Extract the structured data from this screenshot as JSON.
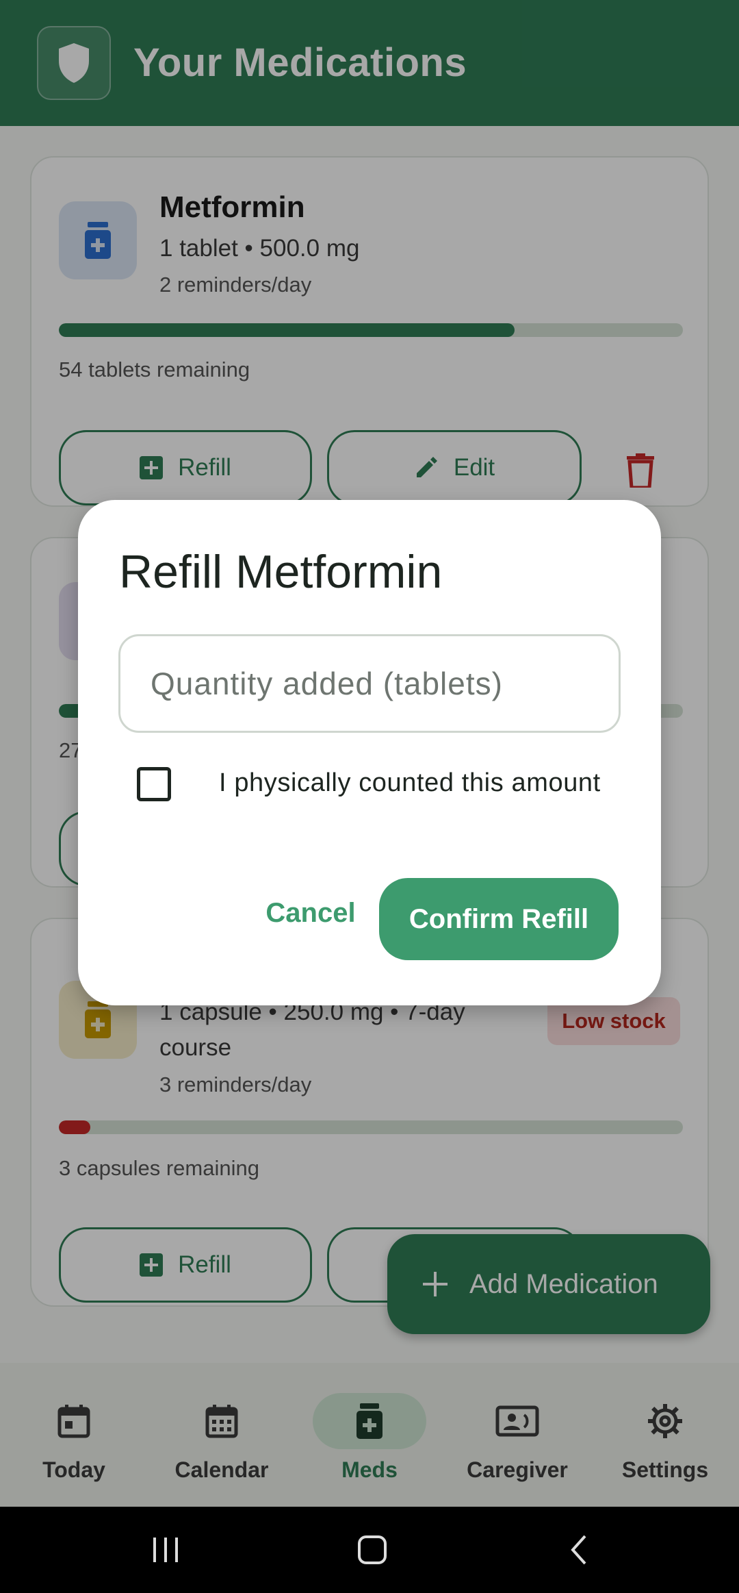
{
  "app": {
    "title": "Your Medications"
  },
  "medications": [
    {
      "name": "Metformin",
      "dose": "1 tablet • 500.0 mg",
      "reminders": "2 reminders/day",
      "remaining": "54 tablets remaining",
      "progress": 0.73,
      "progress_color": "#2f7d56",
      "icon_bg": "#dbe6f5",
      "icon_color": "#2d6fd0"
    },
    {
      "name": "",
      "dose": "",
      "reminders": "",
      "remaining": "27",
      "progress": 0.05,
      "progress_color": "#2f7d56",
      "icon_bg": "#e4def0",
      "icon_color": "#6b57a8"
    },
    {
      "name": "",
      "dose": "1 capsule • 250.0 mg • 7-day",
      "dose_line2": "course",
      "reminders": "3 reminders/day",
      "remaining": "3 capsules remaining",
      "progress": 0.05,
      "progress_color": "#c62828",
      "badge": "Low stock",
      "icon_bg": "#f5ecc8",
      "icon_color": "#c79a00"
    }
  ],
  "card_actions": {
    "refill": "Refill",
    "edit": "Edit"
  },
  "fab": {
    "label": "Add Medication"
  },
  "dialog": {
    "title": "Refill Metformin",
    "quantity_placeholder": "Quantity added (tablets)",
    "checkbox_label": "I physically counted this amount",
    "cancel": "Cancel",
    "confirm": "Confirm Refill"
  },
  "nav": {
    "items": [
      {
        "label": "Today",
        "icon": "calendar-today-icon"
      },
      {
        "label": "Calendar",
        "icon": "calendar-month-icon"
      },
      {
        "label": "Meds",
        "icon": "medication-icon",
        "active": true
      },
      {
        "label": "Caregiver",
        "icon": "caregiver-card-icon"
      },
      {
        "label": "Settings",
        "icon": "gear-icon"
      }
    ]
  },
  "colors": {
    "primary": "#2f7d56",
    "dialog_accent": "#3d9b6e",
    "danger": "#c62828"
  }
}
